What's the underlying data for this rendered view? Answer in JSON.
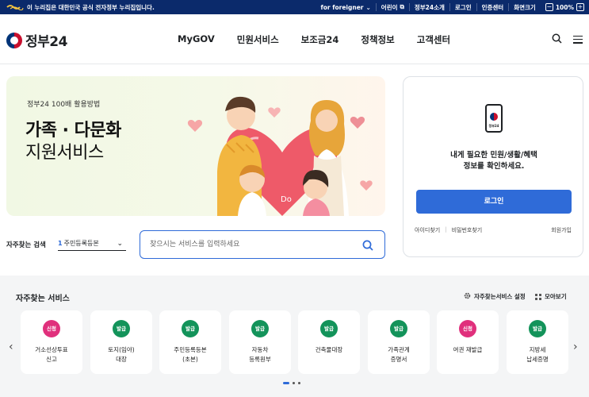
{
  "govbar": {
    "notice": "이 누리집은 대한민국 공식 전자정부 누리집입니다.",
    "links": [
      "for foreigner",
      "어린이",
      "정부24소개",
      "로그인",
      "인증센터",
      "화면크기"
    ],
    "zoom_minus": "−",
    "zoom_value": "100%",
    "zoom_plus": "+"
  },
  "header": {
    "logo": "정부24",
    "nav": [
      "MyGOV",
      "민원서비스",
      "보조금24",
      "정책정보",
      "고객센터"
    ]
  },
  "banner": {
    "small": "정부24 100배 활용방법",
    "title_bold": "가족 · 다문화",
    "title_light": "지원서비스",
    "art_text": "Do"
  },
  "login": {
    "phone_label": "정부24",
    "message_line1": "내게 필요한 민원/생활/혜택",
    "message_line2": "정보를 확인하세요.",
    "button": "로그인",
    "find_id": "아이디찾기",
    "find_pw": "비밀번호찾기",
    "join": "회원가입"
  },
  "search": {
    "fav_label": "자주찾는 검색",
    "fav_num": "1",
    "fav_value": "주민등록등본",
    "placeholder": "찾으시는 서비스를 입력하세요"
  },
  "services": {
    "title": "자주찾는 서비스",
    "setting": "자주찾는서비스 설정",
    "view_all": "모아보기",
    "items": [
      {
        "badge": "신청",
        "label": "거소선상투표\n신고",
        "color": "r"
      },
      {
        "badge": "발급",
        "label": "토지(임야)\n대장",
        "color": "g"
      },
      {
        "badge": "발급",
        "label": "주민등록등본\n(초본)",
        "color": "g"
      },
      {
        "badge": "발급",
        "label": "자동차\n등록원부",
        "color": "g"
      },
      {
        "badge": "발급",
        "label": "건축물대장",
        "color": "g"
      },
      {
        "badge": "발급",
        "label": "가족관계\n증명서",
        "color": "g"
      },
      {
        "badge": "신청",
        "label": "여권 재발급",
        "color": "r"
      },
      {
        "badge": "발급",
        "label": "지방세\n납세증명",
        "color": "g"
      }
    ]
  }
}
